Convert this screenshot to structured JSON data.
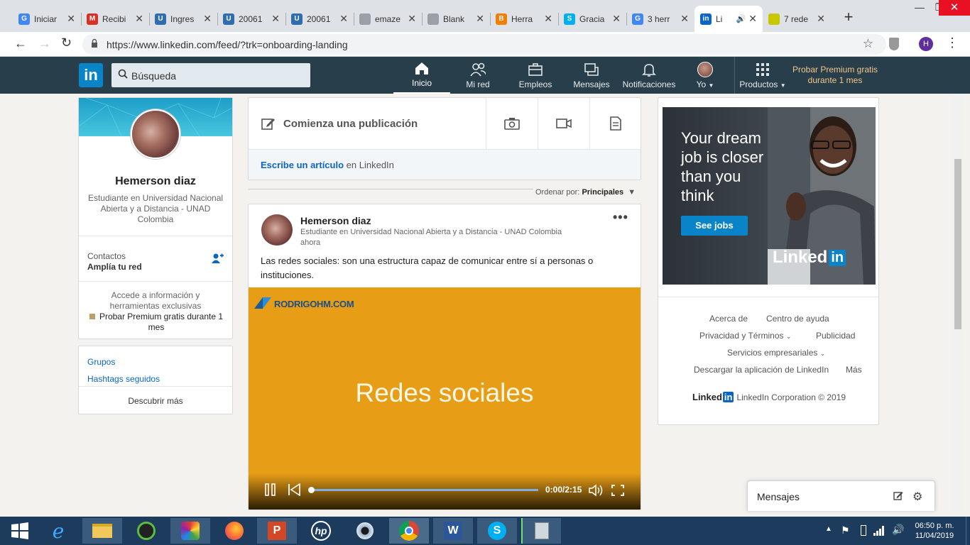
{
  "browser": {
    "tabs": [
      {
        "label": "Iniciar",
        "icon": "google-icon",
        "color": "#4285f4",
        "glyph": "G"
      },
      {
        "label": "Recibi",
        "icon": "gmail-icon",
        "color": "#d93025",
        "glyph": "M"
      },
      {
        "label": "Ingres",
        "icon": "unad-icon",
        "color": "#2f6db0",
        "glyph": "U"
      },
      {
        "label": "20061",
        "icon": "unad-icon",
        "color": "#2f6db0",
        "glyph": "U"
      },
      {
        "label": "20061",
        "icon": "unad-icon",
        "color": "#2f6db0",
        "glyph": "U"
      },
      {
        "label": "emaze",
        "icon": "page-icon",
        "color": "#9aa0a6",
        "glyph": ""
      },
      {
        "label": "Blank",
        "icon": "page-icon",
        "color": "#9aa0a6",
        "glyph": ""
      },
      {
        "label": "Herra",
        "icon": "blogger-icon",
        "color": "#f57d00",
        "glyph": "B"
      },
      {
        "label": "Gracia",
        "icon": "skype-icon",
        "color": "#00aff0",
        "glyph": "S"
      },
      {
        "label": "3 herr",
        "icon": "google-icon",
        "color": "#4285f4",
        "glyph": "G"
      },
      {
        "label": "Li",
        "icon": "linkedin-icon",
        "color": "#0a66c2",
        "glyph": "in",
        "active": true
      },
      {
        "label": "7 rede",
        "icon": "loading-icon",
        "color": "#c8c800",
        "glyph": ""
      }
    ],
    "url": "https://www.linkedin.com/feed/?trk=onboarding-landing",
    "profile_initial": "H"
  },
  "nav": {
    "search_placeholder": "Búsqueda",
    "items": [
      "Inicio",
      "Mi red",
      "Empleos",
      "Mensajes",
      "Notificaciones",
      "Yo",
      "Productos"
    ],
    "premium": "Probar Premium gratis durante 1 mes"
  },
  "profile": {
    "name": "Hemerson diaz",
    "headline": "Estudiante en Universidad Nacional Abierta y a Distancia - UNAD Colombia",
    "contacts_label": "Contactos",
    "contacts_sub": "Amplía tu red",
    "premium_text": "Accede a información y herramientas exclusivas",
    "premium_link": "Probar Premium gratis durante 1 mes",
    "groups": "Grupos",
    "hashtags": "Hashtags seguidos",
    "discover": "Descubrir más"
  },
  "share": {
    "start_post": "Comienza una publicación",
    "write_article": "Escribe un artículo",
    "in_linkedin": "en LinkedIn",
    "sort_label": "Ordenar por:",
    "sort_value": "Principales"
  },
  "post": {
    "author": "Hemerson diaz",
    "headline": "Estudiante en Universidad Nacional Abierta y a Distancia - UNAD Colombia",
    "time": "ahora",
    "text": "Las redes sociales: son una estructura capaz de comunicar entre sí a personas o instituciones.",
    "video_logo": "RODRIGOHM.COM",
    "video_title": "Redes sociales",
    "video_time": "0:00/2:15",
    "video_progress": 0.0
  },
  "ad": {
    "headline": "Your dream job is closer than you think",
    "cta": "See jobs",
    "brand": "LinkedIn"
  },
  "footer": {
    "links": [
      "Acerca de",
      "Centro de ayuda",
      "Privacidad y Términos",
      "Publicidad",
      "Servicios empresariales",
      "Descargar la aplicación de LinkedIn",
      "Más"
    ],
    "copyright": "LinkedIn Corporation © 2019"
  },
  "messages": {
    "label": "Mensajes"
  },
  "taskbar": {
    "time": "06:50 p. m.",
    "date": "11/04/2019"
  },
  "colors": {
    "linkedin_blue": "#0a66c2",
    "nav_bg": "#283e4a",
    "video_bg": "#e89d16",
    "taskbar": "#1c3b5d"
  }
}
